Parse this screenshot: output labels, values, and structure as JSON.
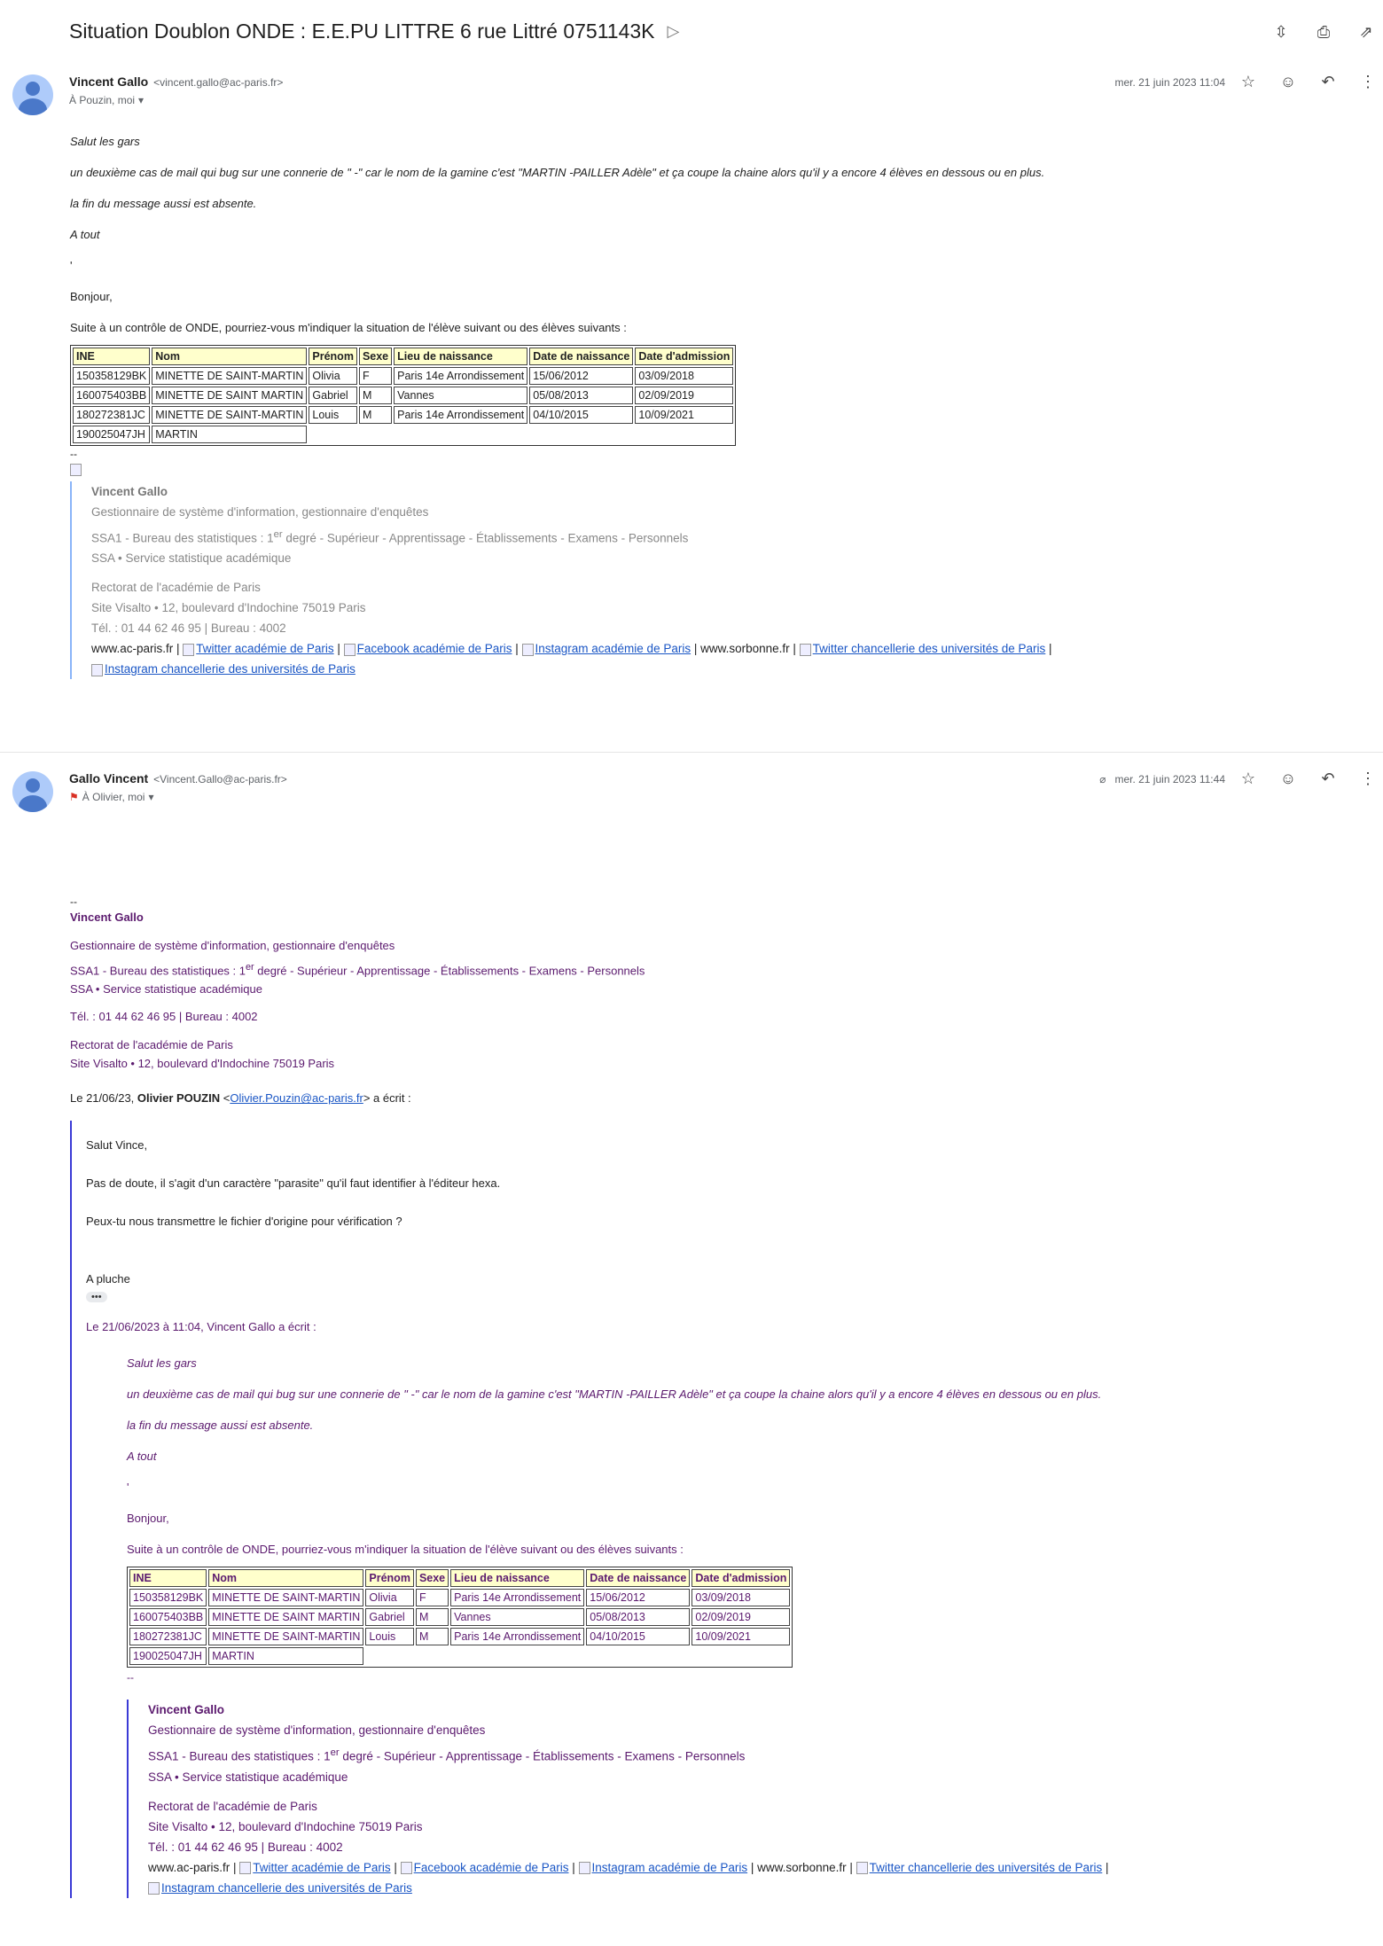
{
  "subject": "Situation Doublon ONDE : E.E.PU LITTRE 6 rue Littré 0751143K",
  "top_actions": [
    "collapse-all",
    "print",
    "open-in-new-window"
  ],
  "messages": [
    {
      "sender_name": "Vincent Gallo",
      "sender_email": "<vincent.gallo@ac-paris.fr>",
      "recipients": "À Pouzin, moi",
      "date": "mer. 21 juin 2023 11:04",
      "body": {
        "greeting": "Salut les gars",
        "line1": "un deuxième cas de mail qui bug sur une connerie de \" -\"  car le nom de la gamine c'est \"MARTIN -PAILLER Adèle\" et ça coupe la chaine alors qu'il y a encore 4 élèves en dessous ou en plus.",
        "line2": "la fin du message aussi est absente.",
        "line3": "A tout",
        "comma": "'",
        "bonjour": "Bonjour,",
        "request": "Suite à un contrôle de ONDE, pourriez-vous m'indiquer la situation de l'élève suivant ou des élèves suivants :",
        "dashes": "--"
      }
    },
    {
      "sender_name": "Gallo Vincent",
      "sender_email": "<Vincent.Gallo@ac-paris.fr>",
      "recipients": "À Olivier, moi",
      "date": "mer. 21 juin 2023 11:44"
    }
  ],
  "table": {
    "headers": [
      "INE",
      "Nom",
      "Prénom",
      "Sexe",
      "Lieu de naissance",
      "Date de naissance",
      "Date d'admission"
    ],
    "rows": [
      [
        "150358129BK",
        "MINETTE DE SAINT-MARTIN",
        "Olivia",
        "F",
        "Paris 14e Arrondissement",
        "15/06/2012",
        "03/09/2018"
      ],
      [
        "160075403BB",
        "MINETTE DE SAINT MARTIN",
        "Gabriel",
        "M",
        "Vannes",
        "05/08/2013",
        "02/09/2019"
      ],
      [
        "180272381JC",
        "MINETTE DE SAINT-MARTIN",
        "Louis",
        "M",
        "Paris 14e Arrondissement",
        "04/10/2015",
        "10/09/2021"
      ],
      [
        "190025047JH",
        "MARTIN"
      ]
    ]
  },
  "signature": {
    "name": "Vincent Gallo",
    "role": "Gestionnaire de système d'information, gestionnaire d'enquêtes",
    "bureau_pre": "SSA1 - Bureau des statistiques : 1",
    "bureau_sup": "er",
    "bureau_post": " degré - Supérieur - Apprentissage - Établissements - Examens - Personnels",
    "service": "SSA • Service statistique académique",
    "rectorat": "Rectorat de l'académie de Paris",
    "site": "Site Visalto • 12, boulevard d'Indochine 75019 Paris",
    "tel": "Tél. : 01 44 62 46 95 | Bureau : 4002",
    "site1": "www.ac-paris.fr",
    "twitter": "Twitter académie de Paris",
    "facebook": "Facebook académie de Paris",
    "instagram": "Instagram académie de Paris",
    "site2": "www.sorbonne.fr",
    "twitter_chanc": "Twitter chancellerie des universités de Paris",
    "instagram_chanc": "Instagram chancellerie des universités de Paris",
    "sep": " | ",
    "sep_end": " |"
  },
  "reply": {
    "quote_intro_pre": "Le 21/06/23,",
    "quote_author": "Olivier POUZIN",
    "quote_email": "Olivier.Pouzin@ac-paris.fr",
    "quote_intro_post": "a écrit :",
    "salut": "Salut Vince,",
    "p1": "Pas de doute, il s'agit d'un caractère \"parasite\" qu'il faut identifier à l'éditeur hexa.",
    "p2": "Peux-tu nous transmettre le fichier d'origine pour vérification ?",
    "sign": "A pluche",
    "dots": "•••",
    "nested_intro": "Le 21/06/2023 à 11:04, Vincent Gallo a écrit :"
  }
}
